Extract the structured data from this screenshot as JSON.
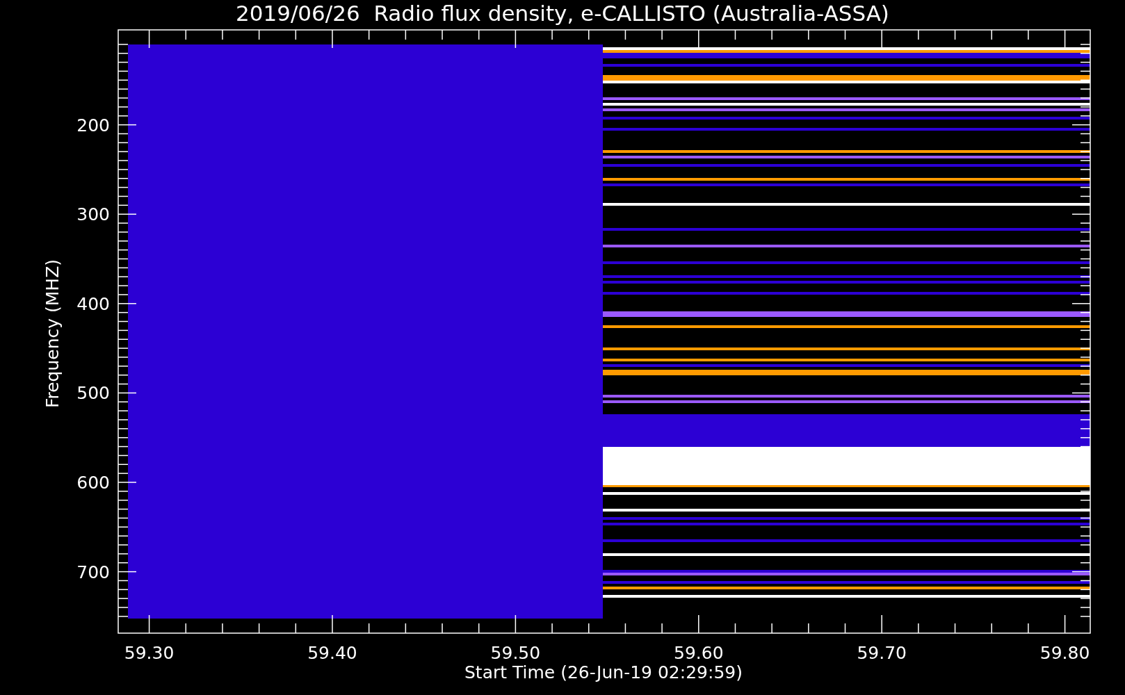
{
  "title": "2019/06/26  Radio flux density, e-CALLISTO (Australia-ASSA)",
  "ylabel": "Frequency (MHZ)",
  "xlabel": "Start Time (26-Jun-19 02:29:59)",
  "yticks": [
    "200",
    "300",
    "400",
    "500",
    "600",
    "700"
  ],
  "xticks": [
    "59.30",
    "59.40",
    "59.50",
    "59.60",
    "59.70",
    "59.80"
  ]
}
